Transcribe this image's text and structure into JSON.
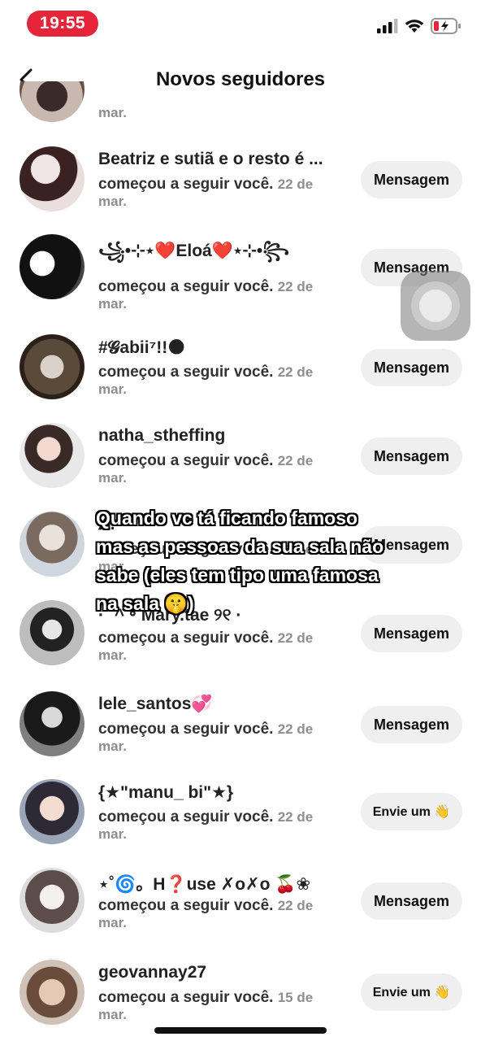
{
  "status": {
    "time": "19:55"
  },
  "header": {
    "title": "Novos seguidores"
  },
  "top_partial": {
    "date_tail": "mar."
  },
  "rows": [
    {
      "name": "Beatriz e sutiã e o resto é ...",
      "action": "começou a seguir você.",
      "date": "22 de mar.",
      "button": "Mensagem"
    },
    {
      "name": "꧁•⊹٭❤️Eloá❤️٭⊹•꧂",
      "action": "começou a seguir você.",
      "date": "22 de mar.",
      "button": "Mensagem"
    },
    {
      "name": "#𝓖abii⁷!!🌑",
      "action": "começou a seguir você.",
      "date": "22 de mar.",
      "button": "Mensagem"
    },
    {
      "name": "natha_stheffing",
      "action": "começou a seguir você.",
      "date": "22 de mar.",
      "button": "Mensagem"
    },
    {
      "name": "𝑨.",
      "action": "começou a seguir você.",
      "date": "22 de mar.",
      "button": "Mensagem"
    },
    {
      "name": "·ˆ ^ ॰ Mary.tae ୨୧ ·",
      "action": "começou a seguir você.",
      "date": "22 de mar.",
      "button": "Mensagem"
    },
    {
      "name": "lele_santos💞",
      "action": "começou a seguir você.",
      "date": "22 de mar.",
      "button": "Mensagem"
    },
    {
      "name": "{★\"manu_ bi\"★}",
      "action": "começou a seguir você.",
      "date": "22 de mar.",
      "button": "Envie um 👋"
    },
    {
      "name": "⋆˚🌀。H❓use ✗o✗o 🍒❀",
      "action": "começou a seguir você.",
      "date": "22 de mar.",
      "button": "Mensagem"
    },
    {
      "name": "geovannay27",
      "action": "começou a seguir você.",
      "date": "15 de mar.",
      "button": "Envie um 👋"
    }
  ],
  "overlay": {
    "text": "Quando vc tá ficando famoso mas as pessoas da sua sala não sabe (eles tem tipo uma famosa na sala 🤫)"
  },
  "colors": {
    "time_pill": "#e5253a",
    "button_bg": "#efefef",
    "muted": "#8e8e8e"
  }
}
